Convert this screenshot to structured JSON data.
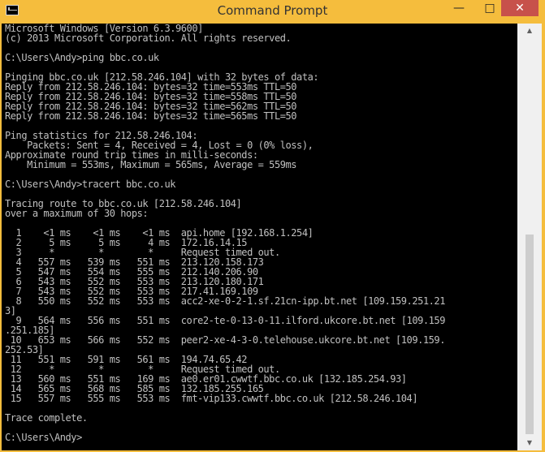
{
  "window": {
    "title": "Command Prompt",
    "controls": {
      "minimize": "—",
      "maximize": "□",
      "close": "✕"
    }
  },
  "scrollbar": {
    "up_arrow": "▲",
    "down_arrow": "▼"
  },
  "console": {
    "lines": [
      "Microsoft Windows [Version 6.3.9600]",
      "(c) 2013 Microsoft Corporation. All rights reserved.",
      "",
      "C:\\Users\\Andy>ping bbc.co.uk",
      "",
      "Pinging bbc.co.uk [212.58.246.104] with 32 bytes of data:",
      "Reply from 212.58.246.104: bytes=32 time=553ms TTL=50",
      "Reply from 212.58.246.104: bytes=32 time=558ms TTL=50",
      "Reply from 212.58.246.104: bytes=32 time=562ms TTL=50",
      "Reply from 212.58.246.104: bytes=32 time=565ms TTL=50",
      "",
      "Ping statistics for 212.58.246.104:",
      "    Packets: Sent = 4, Received = 4, Lost = 0 (0% loss),",
      "Approximate round trip times in milli-seconds:",
      "    Minimum = 553ms, Maximum = 565ms, Average = 559ms",
      "",
      "C:\\Users\\Andy>tracert bbc.co.uk",
      "",
      "Tracing route to bbc.co.uk [212.58.246.104]",
      "over a maximum of 30 hops:",
      "",
      "  1    <1 ms    <1 ms    <1 ms  api.home [192.168.1.254]",
      "  2     5 ms     5 ms     4 ms  172.16.14.15",
      "  3     *        *        *     Request timed out.",
      "  4   557 ms   539 ms   551 ms  213.120.158.173",
      "  5   547 ms   554 ms   555 ms  212.140.206.90",
      "  6   543 ms   552 ms   553 ms  213.120.180.171",
      "  7   543 ms   552 ms   553 ms  217.41.169.109",
      "  8   550 ms   552 ms   553 ms  acc2-xe-0-2-1.sf.21cn-ipp.bt.net [109.159.251.21",
      "3]",
      "  9   564 ms   556 ms   551 ms  core2-te-0-13-0-11.ilford.ukcore.bt.net [109.159",
      ".251.185]",
      " 10   653 ms   566 ms   552 ms  peer2-xe-4-3-0.telehouse.ukcore.bt.net [109.159.",
      "252.53]",
      " 11   551 ms   591 ms   561 ms  194.74.65.42",
      " 12     *        *        *     Request timed out.",
      " 13   560 ms   551 ms   169 ms  ae0.er01.cwwtf.bbc.co.uk [132.185.254.93]",
      " 14   565 ms   568 ms   585 ms  132.185.255.165",
      " 15   557 ms   555 ms   553 ms  fmt-vip133.cwwtf.bbc.co.uk [212.58.246.104]",
      "",
      "Trace complete.",
      "",
      "C:\\Users\\Andy>"
    ]
  }
}
